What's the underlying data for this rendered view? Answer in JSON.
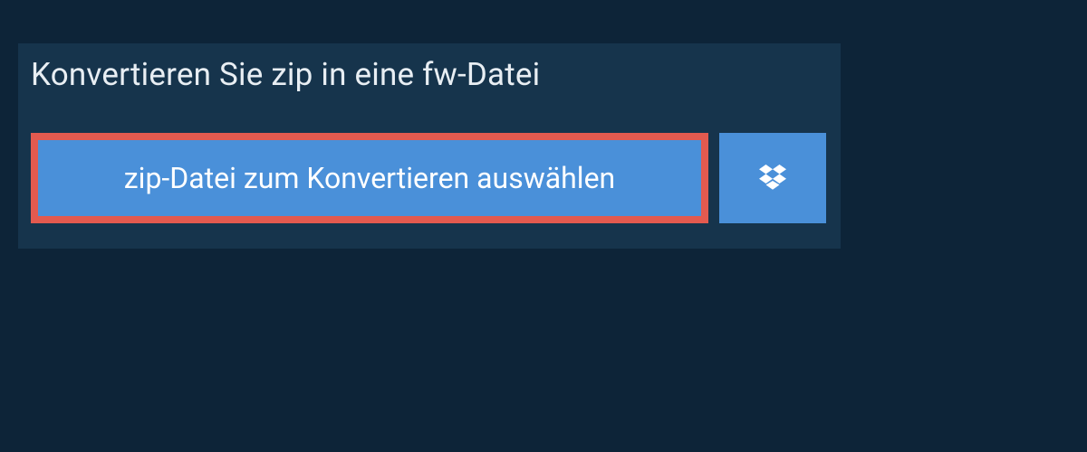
{
  "heading": "Konvertieren Sie zip in eine fw-Datei",
  "file_select_label": "zip-Datei zum Konvertieren auswählen",
  "colors": {
    "background": "#0d2438",
    "panel": "#16344c",
    "button": "#4a90d9",
    "highlight_border": "#e35a4f",
    "text_light": "#e8eef3",
    "text_white": "#ffffff"
  }
}
